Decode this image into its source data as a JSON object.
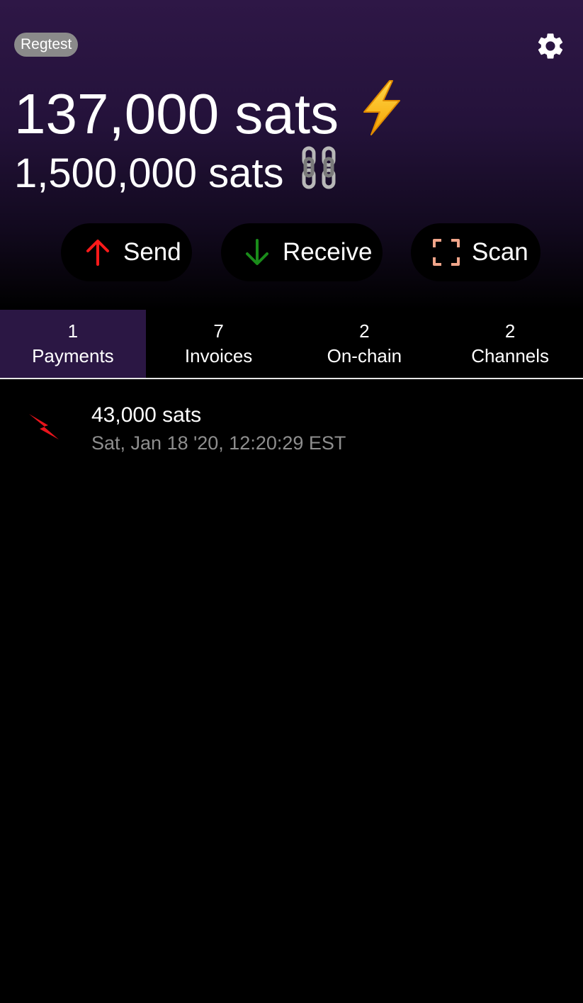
{
  "header": {
    "network_badge": "Regtest",
    "lightning_balance": "137,000 sats",
    "lightning_emoji": "⚡",
    "onchain_balance": "1,500,000 sats",
    "onchain_emoji": "⛓",
    "settings_icon": "gear-icon"
  },
  "actions": {
    "send_label": "Send",
    "receive_label": "Receive",
    "scan_label": "Scan"
  },
  "tabs": [
    {
      "count": "1",
      "label": "Payments",
      "active": true
    },
    {
      "count": "7",
      "label": "Invoices",
      "active": false
    },
    {
      "count": "2",
      "label": "On-chain",
      "active": false
    },
    {
      "count": "2",
      "label": "Channels",
      "active": false
    }
  ],
  "payments": [
    {
      "amount": "43,000 sats",
      "date": "Sat, Jan 18 '20, 12:20:29 EST",
      "icon": "lightning-bolt-icon"
    }
  ],
  "colors": {
    "header_top": "#2e1746",
    "active_tab": "#2b1744",
    "send_arrow": "#ff1a1a",
    "receive_arrow": "#1a8c1a",
    "scan_frame": "#f0a58a",
    "payment_bolt": "#e8141c",
    "badge": "#8a8a8a",
    "secondary_text": "#8e8e8e"
  }
}
